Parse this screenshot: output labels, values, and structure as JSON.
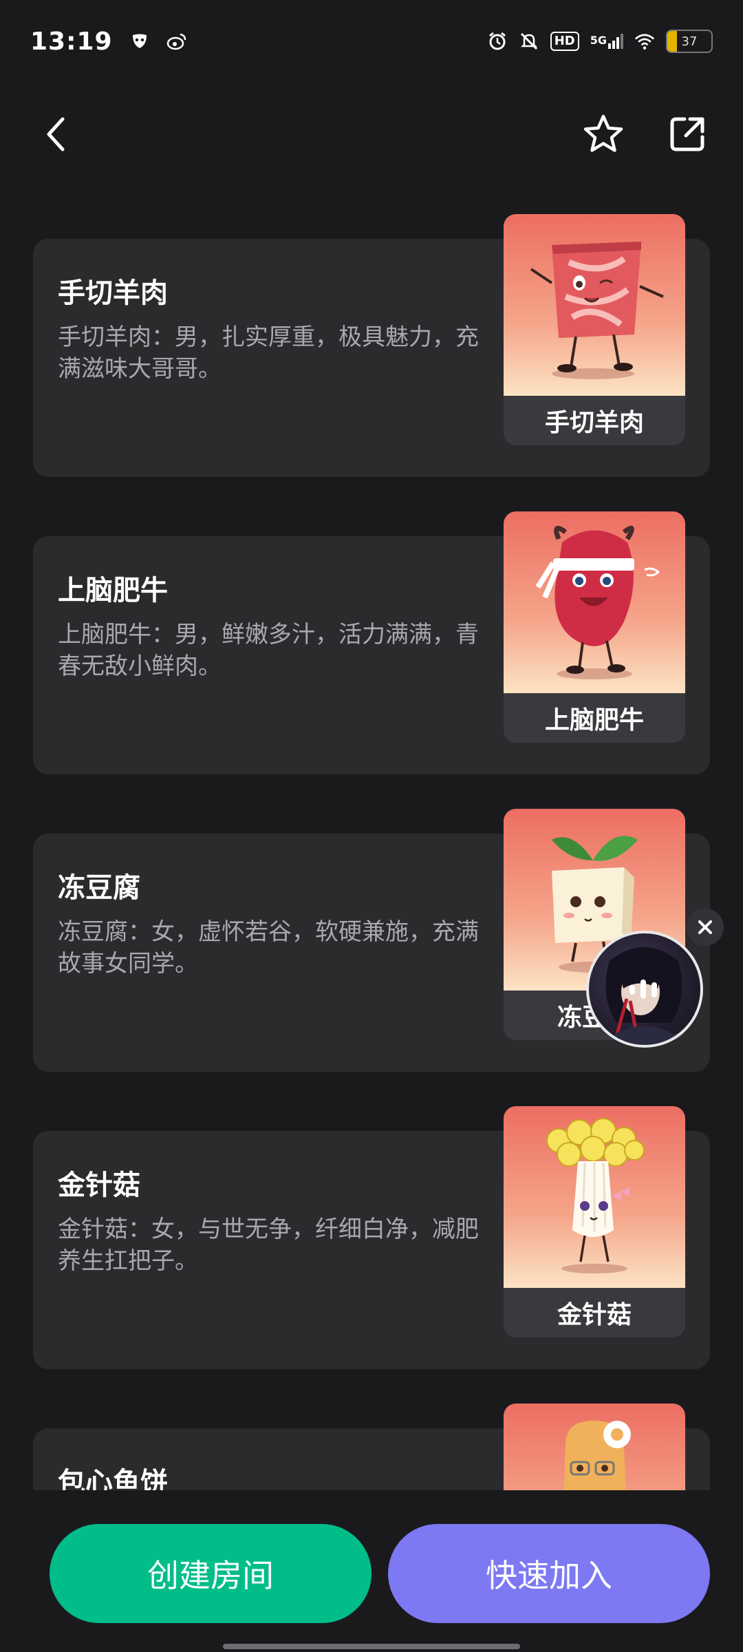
{
  "status_bar": {
    "time": "13:19",
    "icons": [
      "mask-icon",
      "weibo-icon",
      "alarm-icon",
      "mute-icon",
      "hd-icon",
      "signal-5g-icon",
      "wifi-icon",
      "battery-icon"
    ],
    "hd_label": "HD",
    "network_label": "5G",
    "battery_level": "37"
  },
  "header": {
    "icons": [
      "back-arrow-icon",
      "star-icon",
      "share-icon"
    ]
  },
  "partial_heading": "",
  "cards": [
    {
      "title": "手切羊肉",
      "description": "手切羊肉：男，扎实厚重，极具魅力，充满滋味大哥哥。",
      "tile_label": "手切羊肉"
    },
    {
      "title": "上脑肥牛",
      "description": "上脑肥牛：男，鲜嫩多汁，活力满满，青春无敌小鲜肉。",
      "tile_label": "上脑肥牛"
    },
    {
      "title": "冻豆腐",
      "description": "冻豆腐：女，虚怀若谷，软硬兼施，充满故事女同学。",
      "tile_label": "冻豆腐"
    },
    {
      "title": "金针菇",
      "description": "金针菇：女，与世无争，纤细白净，减肥养生扛把子。",
      "tile_label": "金针菇"
    },
    {
      "title": "包心鱼饼",
      "description": "",
      "tile_label": ""
    }
  ],
  "colors": {
    "background": "#1a1a1d",
    "card": "#2b2b2e",
    "create_button": "#00bd8a",
    "join_button": "#7d79f2"
  },
  "buttons": {
    "create": "创建房间",
    "join": "快速加入"
  }
}
